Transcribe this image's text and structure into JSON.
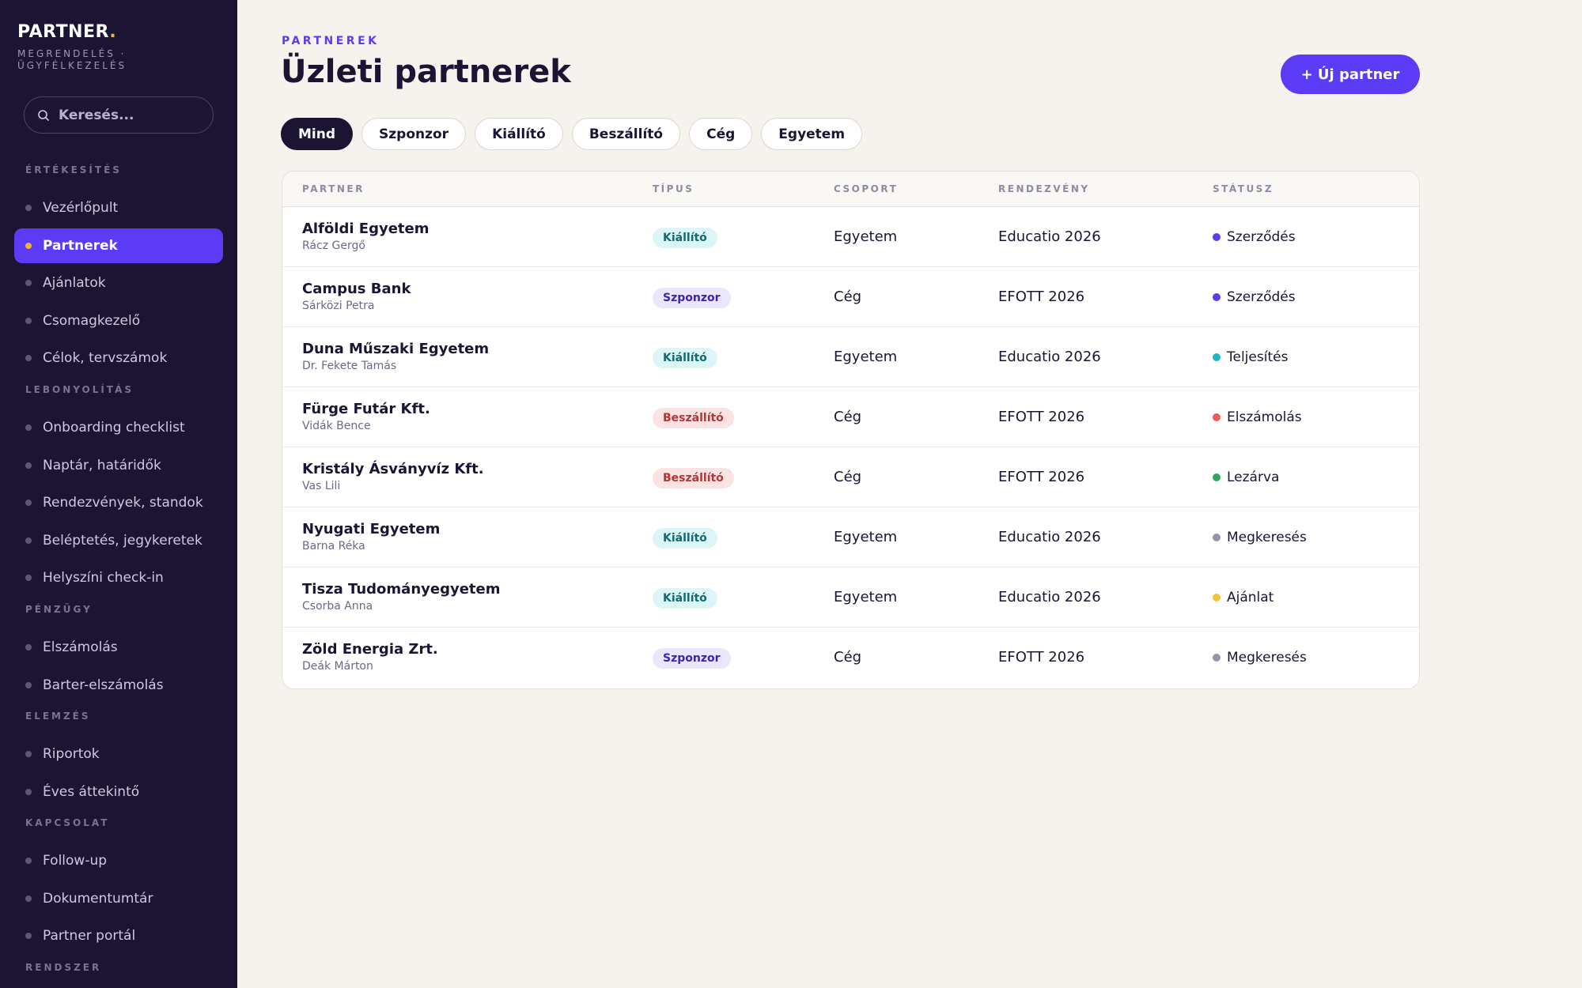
{
  "sidebar": {
    "brand": "PARTNER",
    "brand_dot": ".",
    "subtitle": "MEGRENDELÉS · ÜGYFÉLKEZELÉS",
    "search_placeholder": "Keresés...",
    "sections": [
      {
        "label": "ÉRTÉKESÍTÉS",
        "items": [
          "Vezérlőpult",
          "Partnerek",
          "Ajánlatok",
          "Csomagkezelő",
          "Célok, tervszámok"
        ]
      },
      {
        "label": "LEBONYOLÍTÁS",
        "items": [
          "Onboarding checklist",
          "Naptár, határidők",
          "Rendezvények, standok",
          "Beléptetés, jegykeretek",
          "Helyszíni check-in"
        ]
      },
      {
        "label": "PÉNZÜGY",
        "items": [
          "Elszámolás",
          "Barter-elszámolás"
        ]
      },
      {
        "label": "ELEMZÉS",
        "items": [
          "Riportok",
          "Éves áttekintő"
        ]
      },
      {
        "label": "KAPCSOLAT",
        "items": [
          "Follow-up",
          "Dokumentumtár",
          "Partner portál"
        ]
      },
      {
        "label": "RENDSZER",
        "items": []
      }
    ],
    "active_item": "Partnerek"
  },
  "header": {
    "eyebrow": "PARTNEREK",
    "title": "Üzleti partnerek",
    "new_button": "+ Új partner"
  },
  "filters": [
    "Mind",
    "Szponzor",
    "Kiállító",
    "Beszállító",
    "Cég",
    "Egyetem"
  ],
  "active_filter": "Mind",
  "table": {
    "columns": [
      "PARTNER",
      "TÍPUS",
      "CSOPORT",
      "RENDEZVÉNY",
      "STÁTUSZ"
    ],
    "rows": [
      {
        "name": "Alföldi Egyetem",
        "contact": "Rácz Gergő",
        "type": "Kiállító",
        "type_key": "kiallito",
        "group": "Egyetem",
        "event": "Educatio 2026",
        "status": "Szerződés",
        "status_color": "#5b3bf5"
      },
      {
        "name": "Campus Bank",
        "contact": "Sárközi Petra",
        "type": "Szponzor",
        "type_key": "szponzor",
        "group": "Cég",
        "event": "EFOTT 2026",
        "status": "Szerződés",
        "status_color": "#5b3bf5"
      },
      {
        "name": "Duna Műszaki Egyetem",
        "contact": "Dr. Fekete Tamás",
        "type": "Kiállító",
        "type_key": "kiallito",
        "group": "Egyetem",
        "event": "Educatio 2026",
        "status": "Teljesítés",
        "status_color": "#22b5c9"
      },
      {
        "name": "Fürge Futár Kft.",
        "contact": "Vidák Bence",
        "type": "Beszállító",
        "type_key": "beszallito",
        "group": "Cég",
        "event": "EFOTT 2026",
        "status": "Elszámolás",
        "status_color": "#ef5a5a"
      },
      {
        "name": "Kristály Ásványvíz Kft.",
        "contact": "Vas Lili",
        "type": "Beszállító",
        "type_key": "beszallito",
        "group": "Cég",
        "event": "EFOTT 2026",
        "status": "Lezárva",
        "status_color": "#2fa65c"
      },
      {
        "name": "Nyugati Egyetem",
        "contact": "Barna Réka",
        "type": "Kiállító",
        "type_key": "kiallito",
        "group": "Egyetem",
        "event": "Educatio 2026",
        "status": "Megkeresés",
        "status_color": "#9893a6"
      },
      {
        "name": "Tisza Tudományegyetem",
        "contact": "Csorba Anna",
        "type": "Kiállító",
        "type_key": "kiallito",
        "group": "Egyetem",
        "event": "Educatio 2026",
        "status": "Ajánlat",
        "status_color": "#f5c23a"
      },
      {
        "name": "Zöld Energia Zrt.",
        "contact": "Deák Márton",
        "type": "Szponzor",
        "type_key": "szponzor",
        "group": "Cég",
        "event": "EFOTT 2026",
        "status": "Megkeresés",
        "status_color": "#9893a6"
      }
    ]
  },
  "icons": {
    "search": "search-icon"
  },
  "colors": {
    "sidebar_bg": "#1c1433",
    "accent": "#5b3bf5",
    "highlight": "#f5b23a",
    "page_bg": "#f6f3ee"
  }
}
